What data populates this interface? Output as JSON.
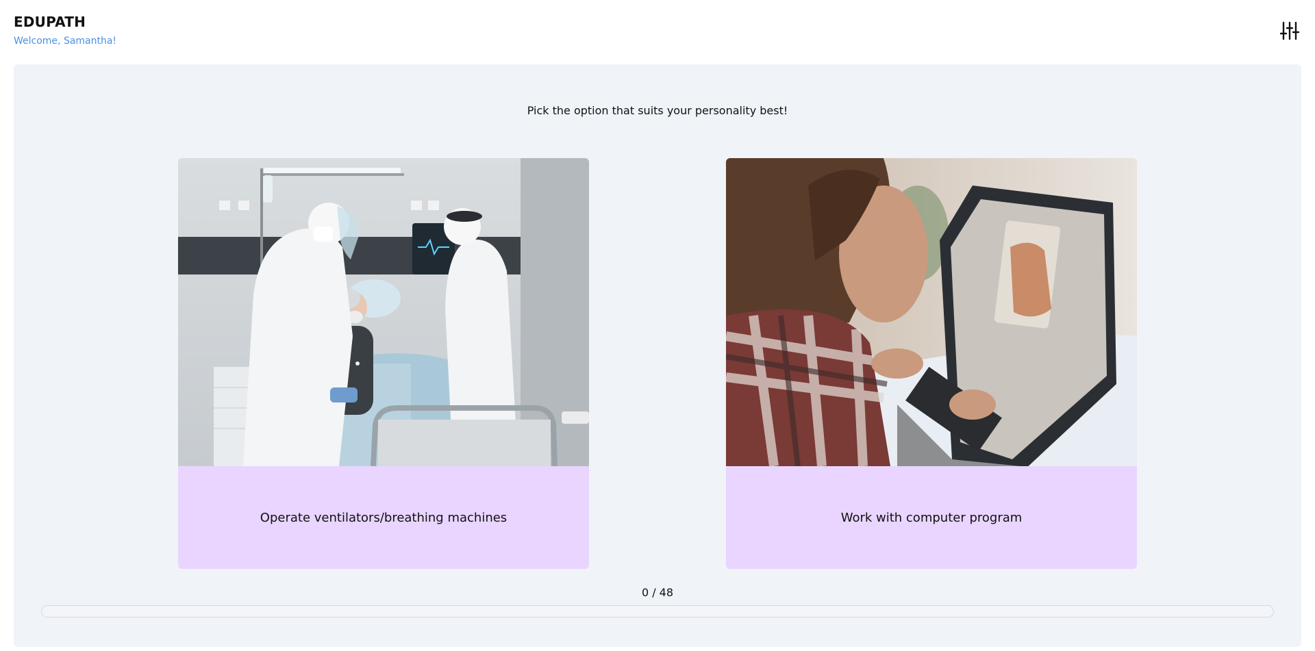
{
  "app": {
    "title": "EDUPATH",
    "welcome": "Welcome, Samantha!"
  },
  "header": {
    "settings_icon": "sliders-icon"
  },
  "quiz": {
    "prompt": "Pick the option that suits your personality best!",
    "options": [
      {
        "label": "Operate ventilators/breathing machines",
        "image": "hospital-icu-photo"
      },
      {
        "label": "Work with computer program",
        "image": "laptop-work-photo"
      }
    ],
    "progress": {
      "current": 0,
      "total": 48,
      "text": "0 / 48",
      "fraction": 0
    }
  },
  "colors": {
    "accent": "#4a90e2",
    "option_bg": "#e9d5ff",
    "panel_bg": "#f0f3f8"
  }
}
